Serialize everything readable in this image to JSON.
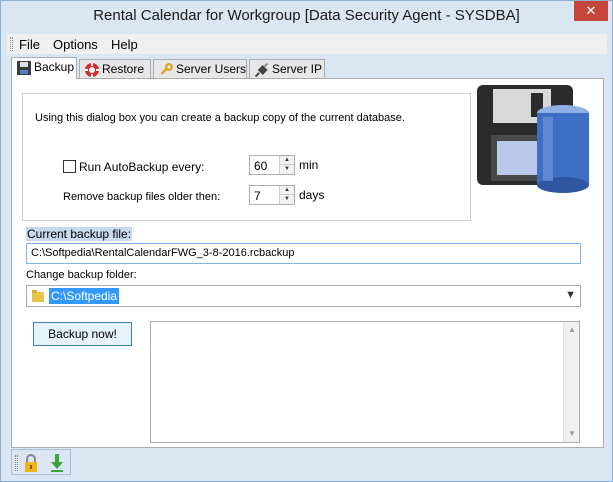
{
  "window": {
    "title": "Rental Calendar for Workgroup [Data Security Agent - SYSDBA]",
    "close_glyph": "✕"
  },
  "menu": {
    "items": [
      {
        "label": "File"
      },
      {
        "label": "Options"
      },
      {
        "label": "Help"
      }
    ]
  },
  "tabs": [
    {
      "label": "Backup",
      "icon": "floppy-icon",
      "active": true
    },
    {
      "label": "Restore",
      "icon": "lifebuoy-icon",
      "active": false
    },
    {
      "label": "Server Users",
      "icon": "key-icon",
      "active": false
    },
    {
      "label": "Server IP",
      "icon": "plug-icon",
      "active": false
    }
  ],
  "backup": {
    "description": "Using this dialog box you can create a backup copy of the current database.",
    "autobackup_label": "Run AutoBackup every:",
    "autobackup_checked": false,
    "autobackup_value": "60",
    "autobackup_unit": "min",
    "remove_label": "Remove backup files older then:",
    "remove_value": "7",
    "remove_unit": "days",
    "current_file_label": "Current backup file:",
    "current_file_value": "C:\\Softpedia\\RentalCalendarFWG_3-8-2016.rcbackup",
    "change_folder_label": "Change backup folder:",
    "folder_value": "C:\\Softpedia",
    "backup_button": "Backup now!",
    "log_text": ""
  },
  "statusbar": {
    "icons": [
      "lock-icon",
      "download-icon"
    ]
  },
  "colors": {
    "window_bg": "#dbe6f3",
    "accent": "#3399ff",
    "close": "#c7463a"
  }
}
